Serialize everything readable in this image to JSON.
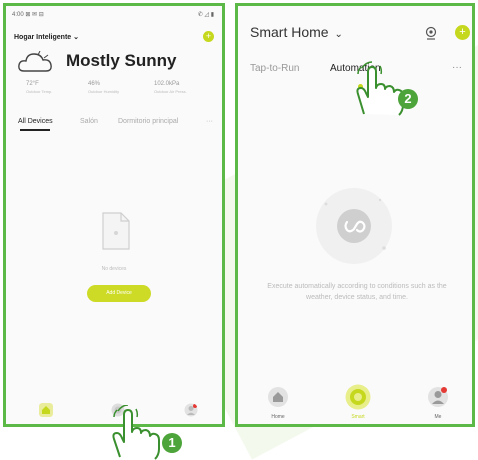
{
  "phone1": {
    "status_left": "4:00 ⊠ ✉ ⊟",
    "status_right": "✆ ◿ ▮",
    "home_title": "Hogar Inteligente ⌄",
    "weather": "Mostly Sunny",
    "stats": [
      {
        "value": "72°F",
        "label": "Outdoor Temp."
      },
      {
        "value": "46%",
        "label": "Outdoor Humidity"
      },
      {
        "value": "102.0kPa",
        "label": "Outdoor Air Press."
      }
    ],
    "tabs": [
      "All Devices",
      "Salón",
      "Dormitorio principal",
      "···"
    ],
    "no_devices": "No devices",
    "add_device": "Add Device"
  },
  "phone2": {
    "title": "Smart Home",
    "title_chevron": "⌄",
    "tabs": [
      "Tap-to-Run",
      "Automation"
    ],
    "more": "···",
    "description": "Execute automatically according to conditions such as the weather, device status, and time.",
    "nav": [
      "Home",
      "Smart",
      "Me"
    ]
  },
  "badges": [
    "1",
    "2"
  ],
  "icons": [
    "cloud-icon",
    "document-icon",
    "home-icon",
    "smart-icon",
    "me-icon",
    "location-icon",
    "plus-icon",
    "automation-icon",
    "pointing-hand-icon"
  ],
  "colors": {
    "accent": "#c6d81e",
    "frame": "#5cb947",
    "badge": "#4da43a"
  }
}
